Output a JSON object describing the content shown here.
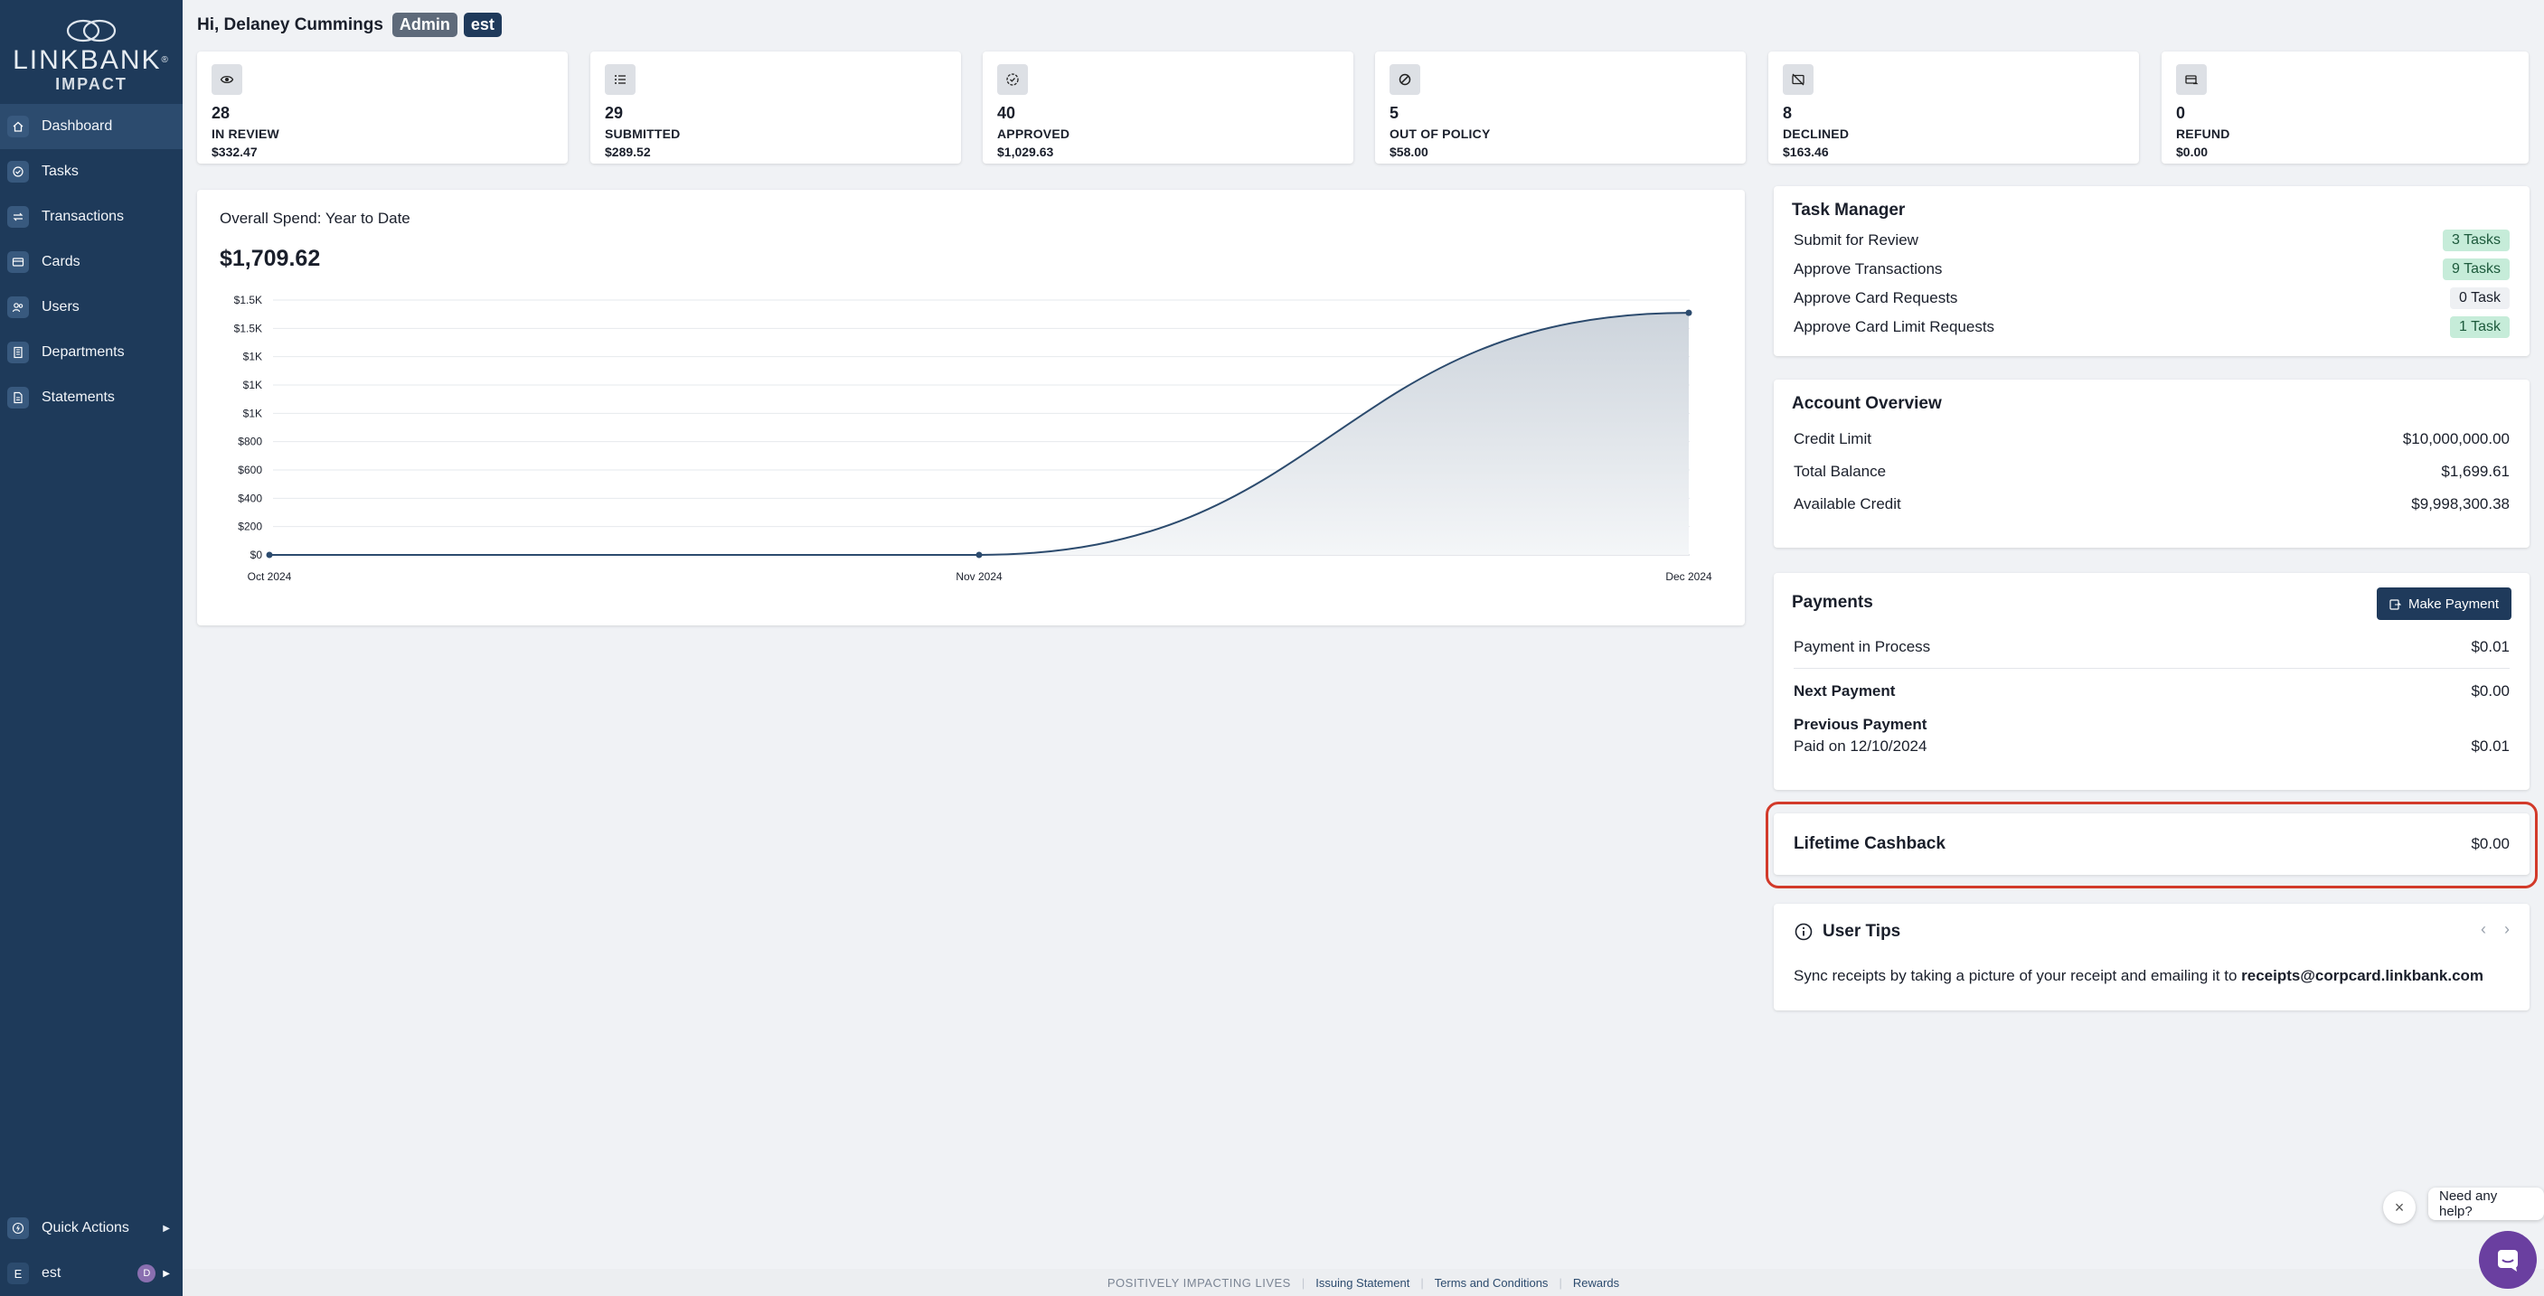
{
  "brand": {
    "name": "LINKBANK",
    "registered": "®",
    "sub": "IMPACT"
  },
  "sidebar": {
    "items": [
      {
        "label": "Dashboard",
        "icon": "home-icon",
        "active": true
      },
      {
        "label": "Tasks",
        "icon": "check-circle-icon"
      },
      {
        "label": "Transactions",
        "icon": "transfer-icon"
      },
      {
        "label": "Cards",
        "icon": "card-icon"
      },
      {
        "label": "Users",
        "icon": "users-icon"
      },
      {
        "label": "Departments",
        "icon": "building-icon"
      },
      {
        "label": "Statements",
        "icon": "document-icon"
      }
    ],
    "quick_actions": "Quick Actions",
    "user": {
      "initial": "E",
      "name": "est",
      "avatar": "D"
    }
  },
  "header": {
    "greeting": "Hi, Delaney Cummings",
    "role_badge": "Admin",
    "org_badge": "est"
  },
  "stats": [
    {
      "icon": "eye-icon",
      "count": "28",
      "label": "IN REVIEW",
      "amount": "$332.47"
    },
    {
      "icon": "list-icon",
      "count": "29",
      "label": "SUBMITTED",
      "amount": "$289.52"
    },
    {
      "icon": "check-badge-icon",
      "count": "40",
      "label": "APPROVED",
      "amount": "$1,029.63"
    },
    {
      "icon": "ban-icon",
      "count": "5",
      "label": "OUT OF POLICY",
      "amount": "$58.00"
    },
    {
      "icon": "card-off-icon",
      "count": "8",
      "label": "DECLINED",
      "amount": "$163.46"
    },
    {
      "icon": "refund-icon",
      "count": "0",
      "label": "REFUND",
      "amount": "$0.00"
    }
  ],
  "spend": {
    "title": "Overall Spend: Year to Date",
    "total": "$1,709.62"
  },
  "chart_data": {
    "type": "area",
    "x": [
      "Oct 2024",
      "Nov 2024",
      "Dec 2024"
    ],
    "values": [
      0,
      0,
      1709.62
    ],
    "y_ticks": [
      0,
      200,
      400,
      600,
      800,
      1000,
      1200,
      1400,
      1600,
      1800
    ],
    "y_tick_labels": [
      "$0",
      "$200",
      "$400",
      "$600",
      "$800",
      "$1K",
      "$1K",
      "$1K",
      "$1.5K",
      "$1.5K"
    ],
    "ylim": [
      0,
      1800
    ],
    "grid": true,
    "line_color": "#2c4b6e"
  },
  "task_manager": {
    "title": "Task Manager",
    "rows": [
      {
        "label": "Submit for Review",
        "badge": "3 Tasks",
        "style": "green"
      },
      {
        "label": "Approve Transactions",
        "badge": "9 Tasks",
        "style": "green"
      },
      {
        "label": "Approve Card Requests",
        "badge": "0 Task",
        "style": "gray"
      },
      {
        "label": "Approve Card Limit Requests",
        "badge": "1 Task",
        "style": "green"
      }
    ]
  },
  "account_overview": {
    "title": "Account Overview",
    "rows": [
      {
        "label": "Credit Limit",
        "value": "$10,000,000.00"
      },
      {
        "label": "Total Balance",
        "value": "$1,699.61"
      },
      {
        "label": "Available Credit",
        "value": "$9,998,300.38"
      }
    ]
  },
  "payments": {
    "title": "Payments",
    "button": "Make Payment",
    "in_process_label": "Payment in Process",
    "in_process_value": "$0.01",
    "next_label": "Next Payment",
    "next_value": "$0.00",
    "prev_label": "Previous Payment",
    "prev_date": "Paid on 12/10/2024",
    "prev_value": "$0.01"
  },
  "cashback": {
    "label": "Lifetime Cashback",
    "value": "$0.00"
  },
  "tips": {
    "title": "User Tips",
    "text": "Sync receipts by taking a picture of your receipt and emailing it to ",
    "email": "receipts@corpcard.linkbank.com"
  },
  "footer": {
    "tagline": "POSITIVELY IMPACTING LIVES",
    "links": [
      "Issuing Statement",
      "Terms and Conditions",
      "Rewards"
    ]
  },
  "help": {
    "bubble": "Need any help?"
  },
  "colors": {
    "sidebar": "#1e3a5a",
    "accent": "#1f3a5b",
    "highlight": "#d23a2a",
    "green_badge": "#c6ecd9"
  }
}
